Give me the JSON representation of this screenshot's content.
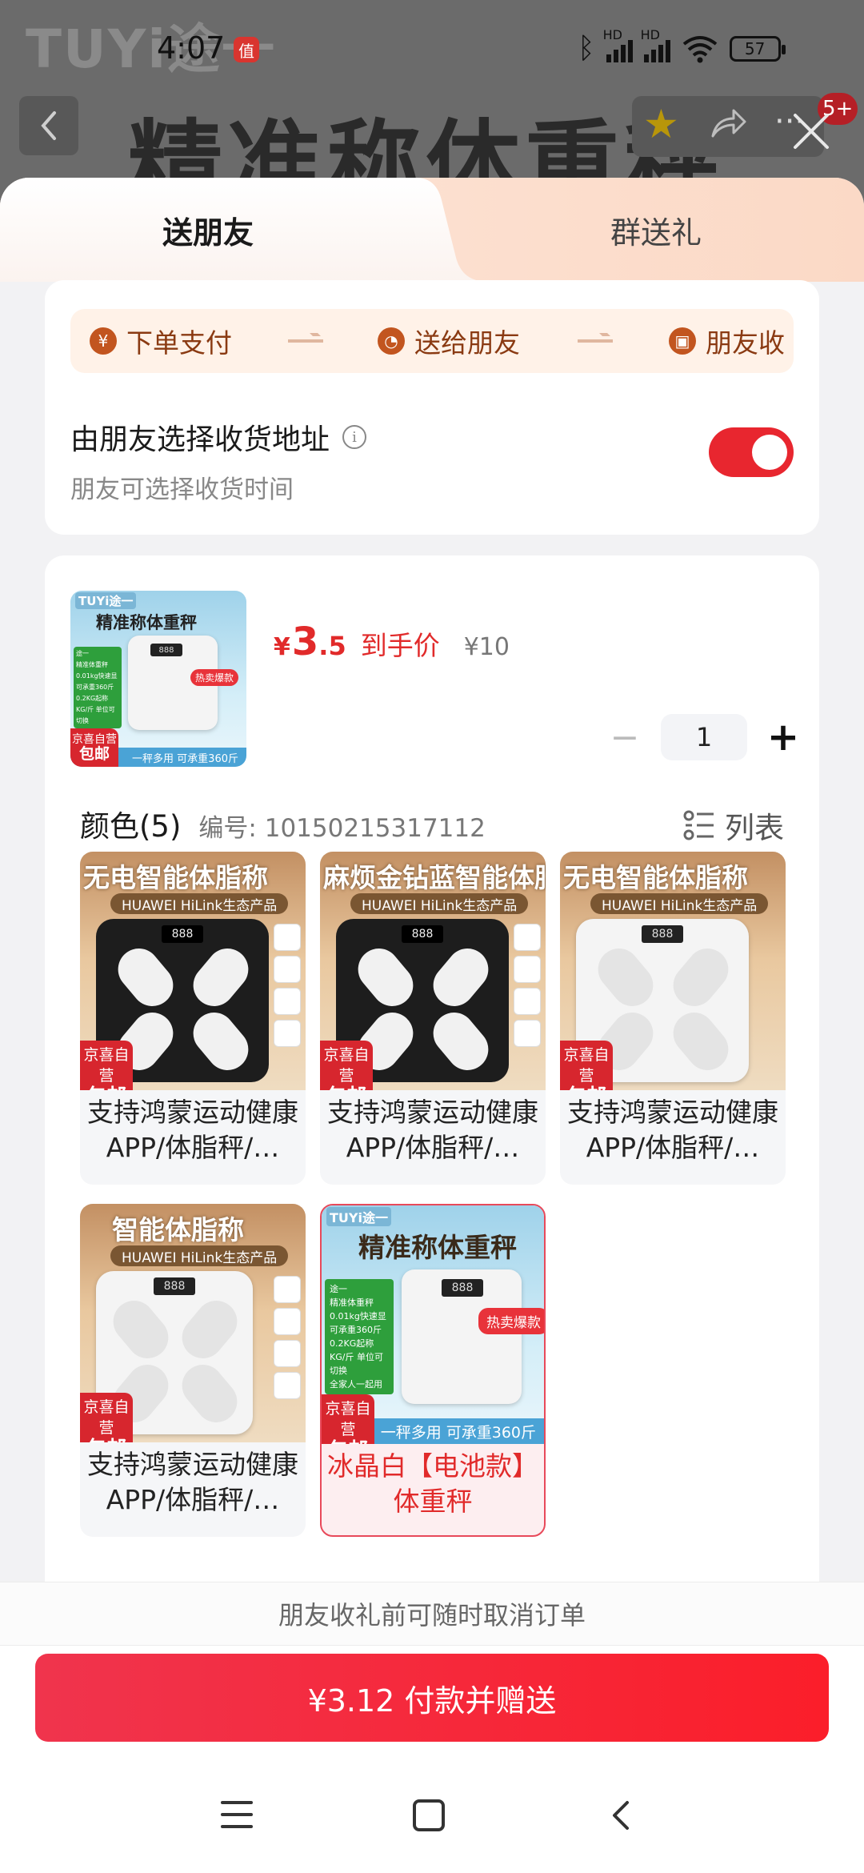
{
  "status_bar": {
    "time": "4:07",
    "app_badge": "值",
    "network_label": "HD",
    "battery": "57"
  },
  "background": {
    "logo": "TUYi途一",
    "title": "精准称体重秤",
    "badge": "5+"
  },
  "tabs": {
    "send_friend": "送朋友",
    "group_gift": "群送礼"
  },
  "flow": {
    "step1": "下单支付",
    "step2": "送给朋友",
    "step3": "朋友收"
  },
  "address": {
    "title": "由朋友选择收货地址",
    "subtitle": "朋友可选择收货时间",
    "toggle_on": true
  },
  "product": {
    "yen": "¥",
    "price_int": "3",
    "price_dec": ".5",
    "price_tag": "到手价",
    "original_price": "¥10",
    "quantity": "1",
    "minus": "−",
    "plus": "+",
    "img_title": "精准称体重秤",
    "img_hot": "热卖爆款",
    "img_strip": "一秤多用 可承重360斤",
    "img_logo": "TUYi途一",
    "img_features": [
      "途一",
      "精准体重秤",
      "0.01kg快速显",
      "可承重360斤",
      "0.2KG起称",
      "KG/斤 单位可切换",
      "全家人一起用"
    ]
  },
  "colors": {
    "title": "颜色(5)",
    "code": "编号: 10150215317112",
    "list_label": "列表",
    "options": [
      {
        "img_title": "无电智能体脂称",
        "img_sub": "HUAWEI HiLink生态产品",
        "label": "支持鸿蒙运动健康APP/体脂秤/…",
        "scale": "black"
      },
      {
        "img_title": "麻烦金钻蓝智能体脂称",
        "img_sub": "HUAWEI HiLink生态产品",
        "label": "支持鸿蒙运动健康APP/体脂秤/…",
        "scale": "black"
      },
      {
        "img_title": "无电智能体脂称",
        "img_sub": "HUAWEI HiLink生态产品",
        "label": "支持鸿蒙运动健康APP/体脂秤/…",
        "scale": "white"
      },
      {
        "img_title": "智能体脂称",
        "img_sub": "HUAWEI HiLink生态产品",
        "label": "支持鸿蒙运动健康APP/体脂秤/…",
        "scale": "white"
      },
      {
        "img_title": "精准称体重秤",
        "img_sub": "",
        "label": "冰晶白【电池款】体重秤",
        "scale": "white",
        "selected": true
      }
    ],
    "badge_top": "京喜自营",
    "badge_bottom": "包邮",
    "display": "888"
  },
  "footer": {
    "note": "朋友收礼前可随时取消订单",
    "pay_button": "¥3.12 付款并赠送"
  },
  "colors_theme": {
    "accent": "#f0344d",
    "price_red": "#e12a2a",
    "toggle": "#e8262f",
    "flow_bg": "#fff2e8"
  }
}
